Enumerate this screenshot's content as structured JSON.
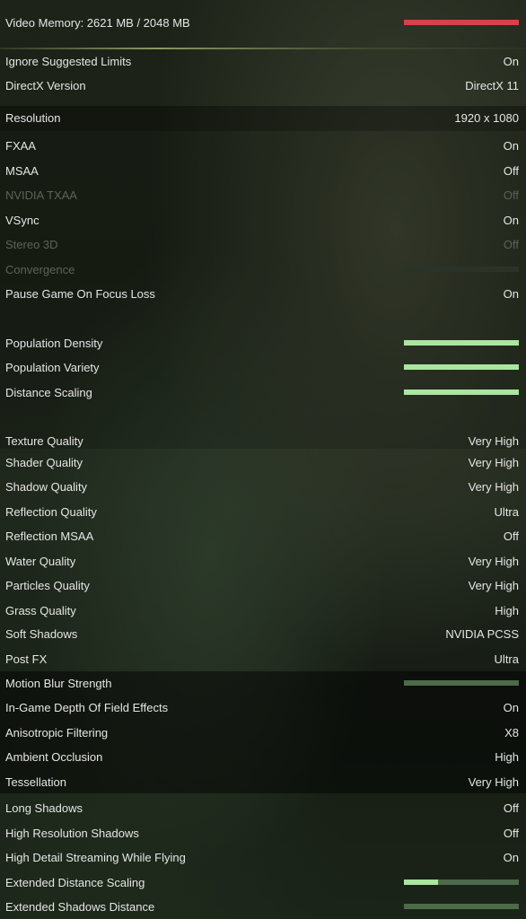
{
  "video_memory": {
    "label": "Video Memory: 2621 MB / 2048 MB",
    "used_mb": 2621,
    "total_mb": 2048,
    "bar_color": "#d9414a",
    "over_limit": true
  },
  "colors": {
    "slider_fill": "#a9e6a0",
    "slider_track": "#4d6a4a",
    "text": "#e6e6e6",
    "disabled_text": "#5c625a"
  },
  "settings": [
    {
      "label": "Ignore Suggested Limits",
      "value": "On"
    },
    {
      "label": "DirectX Version",
      "value": "DirectX 11"
    },
    {
      "label": "Resolution",
      "value": "1920 x 1080"
    },
    {
      "label": "FXAA",
      "value": "On"
    },
    {
      "label": "MSAA",
      "value": "Off"
    },
    {
      "label": "NVIDIA TXAA",
      "value": "Off",
      "disabled": true
    },
    {
      "label": "VSync",
      "value": "On"
    },
    {
      "label": "Stereo 3D",
      "value": "Off",
      "disabled": true
    },
    {
      "label": "Convergence",
      "slider": 0,
      "disabled": true
    },
    {
      "label": "Pause Game On Focus Loss",
      "value": "On"
    },
    {
      "label": "Population Density",
      "slider": 1.0
    },
    {
      "label": "Population Variety",
      "slider": 1.0
    },
    {
      "label": "Distance Scaling",
      "slider": 1.0
    },
    {
      "label": "Texture Quality",
      "value": "Very High"
    },
    {
      "label": "Shader Quality",
      "value": "Very High"
    },
    {
      "label": "Shadow Quality",
      "value": "Very High"
    },
    {
      "label": "Reflection Quality",
      "value": "Ultra"
    },
    {
      "label": "Reflection MSAA",
      "value": "Off"
    },
    {
      "label": "Water Quality",
      "value": "Very High"
    },
    {
      "label": "Particles Quality",
      "value": "Very High"
    },
    {
      "label": "Grass Quality",
      "value": "High"
    },
    {
      "label": "Soft Shadows",
      "value": "NVIDIA PCSS"
    },
    {
      "label": "Post FX",
      "value": "Ultra"
    },
    {
      "label": "Motion Blur Strength",
      "slider": 0
    },
    {
      "label": "In-Game Depth Of Field Effects",
      "value": "On"
    },
    {
      "label": "Anisotropic Filtering",
      "value": "X8"
    },
    {
      "label": "Ambient Occlusion",
      "value": "High"
    },
    {
      "label": "Tessellation",
      "value": "Very High"
    },
    {
      "label": "Long Shadows",
      "value": "Off"
    },
    {
      "label": "High Resolution Shadows",
      "value": "Off"
    },
    {
      "label": "High Detail Streaming While Flying",
      "value": "On"
    },
    {
      "label": "Extended Distance Scaling",
      "slider": 0.3
    },
    {
      "label": "Extended Shadows Distance",
      "slider": 0
    }
  ]
}
